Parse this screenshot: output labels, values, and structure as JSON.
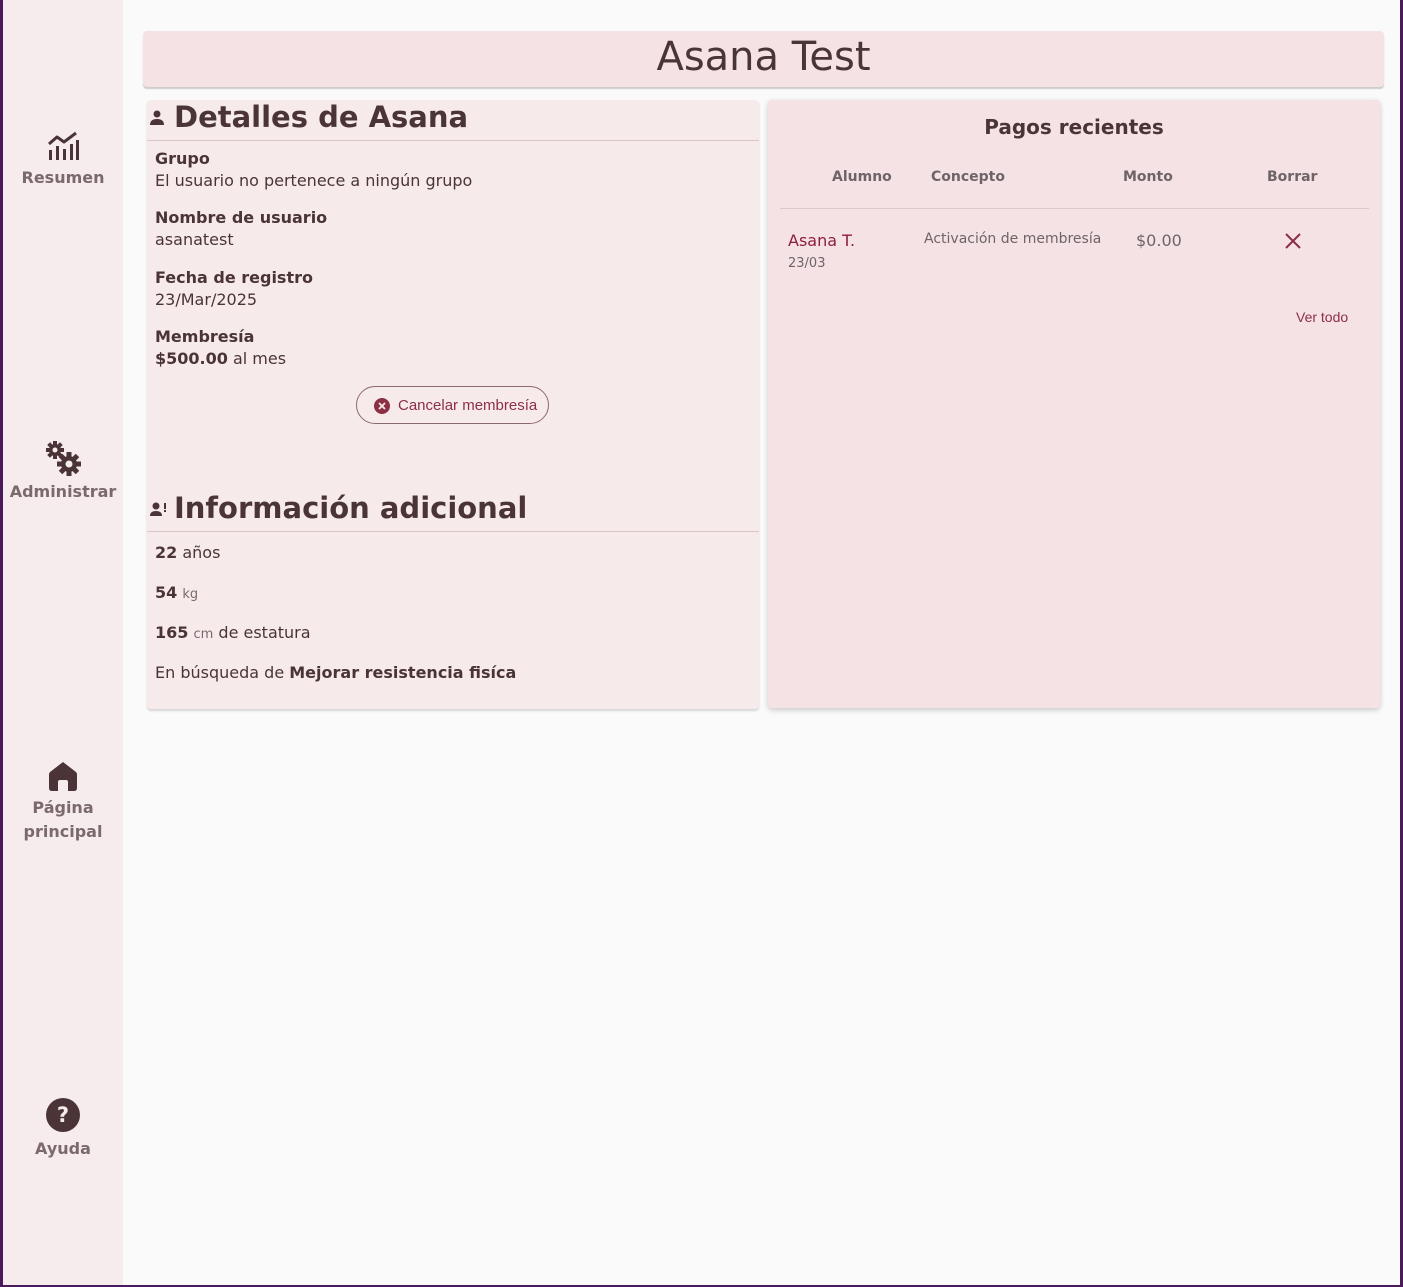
{
  "sidebar": {
    "items": [
      {
        "label": "Resumen",
        "icon": "chart-line-icon"
      },
      {
        "label": "Administrar",
        "icon": "gears-icon"
      },
      {
        "label": "Página principal",
        "icon": "home-icon"
      },
      {
        "label": "Ayuda",
        "icon": "help-icon"
      }
    ]
  },
  "header": {
    "title": "Asana Test"
  },
  "details": {
    "title": "Detalles de Asana",
    "group_label": "Grupo",
    "group_value": "El usuario no pertenece a ningún grupo",
    "username_label": "Nombre de usuario",
    "username_value": "asanatest",
    "registration_label": "Fecha de registro",
    "registration_value": "23/Mar/2025",
    "membership_label": "Membresía",
    "membership_price": "$500.00",
    "membership_period": "al mes",
    "cancel_button": "Cancelar membresía"
  },
  "additional": {
    "title": "Información adicional",
    "age": "22",
    "age_unit": "años",
    "weight": "54",
    "weight_unit": "kg",
    "height": "165",
    "height_unit": "cm",
    "height_suffix": "de estatura",
    "goal_prefix": "En búsqueda de",
    "goal": "Mejorar resistencia fisíca"
  },
  "payments": {
    "title": "Pagos recientes",
    "columns": [
      "Alumno",
      "Concepto",
      "Monto",
      "Borrar"
    ],
    "rows": [
      {
        "student": "Asana T.",
        "date": "23/03",
        "concept": "Activación de membresía",
        "amount": "$0.00"
      }
    ],
    "view_all": "Ver todo"
  },
  "colors": {
    "accent": "#8c2f45",
    "sidebar_bg": "#f7eced",
    "card_bg": "#f5e2e5"
  }
}
